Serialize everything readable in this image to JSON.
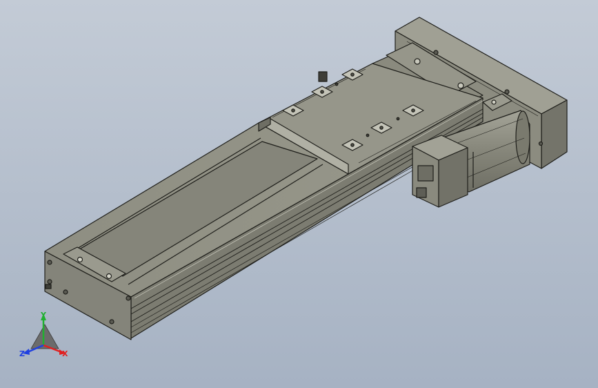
{
  "viewport": {
    "background_top": "#c2cad5",
    "background_bottom": "#a7b3c4",
    "body_color": "#8c8c80",
    "edge_color": "#1e1e1a"
  },
  "triad": {
    "x_label": "X",
    "y_label": "Y",
    "z_label": "Z",
    "x_color": "#e02020",
    "y_color": "#20b030",
    "z_color": "#2040e0"
  }
}
